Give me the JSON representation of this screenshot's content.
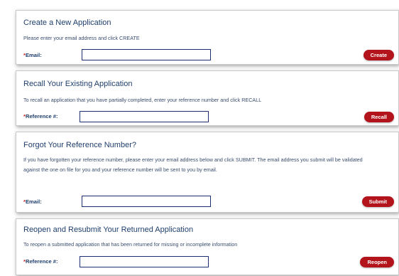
{
  "sections": {
    "create": {
      "title": "Create a New Application",
      "description": "Please enter your email address and click CREATE",
      "field_label": "Email:",
      "field_value": "",
      "button_label": "Create"
    },
    "recall": {
      "title": "Recall Your Existing Application",
      "description": "To recall an application that you have partially completed, enter your reference number and click RECALL",
      "field_label": "Reference #:",
      "field_value": "",
      "button_label": "Recall"
    },
    "forgot": {
      "title": "Forgot Your Reference Number?",
      "description": "If you have forgotten your reference number, please enter your email address below and click SUBMIT. The email address you submit will be validated against the one on file for you and your reference number will be sent to you by email.",
      "field_label": "Email:",
      "field_value": "",
      "button_label": "Submit"
    },
    "reopen": {
      "title": "Reopen and Resubmit Your Returned Application",
      "description": "To reopen a submitted application that has been returned for missing or incomplete information",
      "field_label": "Reference #:",
      "field_value": "",
      "button_label": "Reopen"
    }
  },
  "required_marker": "*",
  "colors": {
    "title_text": "#1f3f6b",
    "required_marker": "#cc1f1f",
    "button_bg": "#b3141c",
    "input_border": "#1c2f73"
  }
}
